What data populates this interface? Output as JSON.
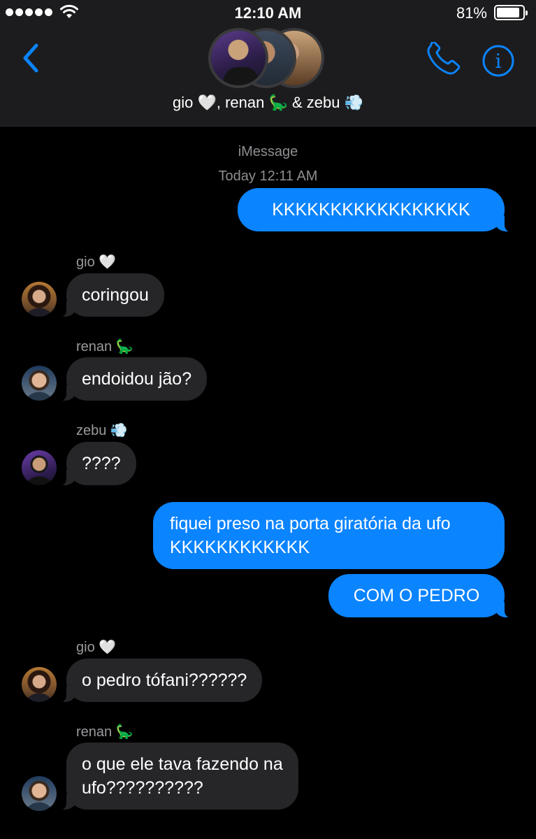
{
  "status_bar": {
    "time": "12:10 AM",
    "battery_percent": "81%",
    "battery_level": 0.81
  },
  "header": {
    "group_name": "gio 🤍, renan 🦕 & zebu 💨",
    "accent_color": "#0b84ff"
  },
  "conversation": {
    "service": "iMessage",
    "timestamp": "Today 12:11 AM",
    "messages": [
      {
        "direction": "sent",
        "text": "KKKKKKKKKKKKKKKKK"
      },
      {
        "direction": "received",
        "sender": "gio 🤍",
        "text": "coringou"
      },
      {
        "direction": "received",
        "sender": "renan 🦕",
        "text": "endoidou jão?"
      },
      {
        "direction": "received",
        "sender": "zebu 💨",
        "text": "????"
      },
      {
        "direction": "sent",
        "text": "fiquei preso na porta giratória da ufo KKKKKKKKKKKK",
        "lines": [
          "fiquei preso na porta giratória da ufo",
          "KKKKKKKKKKKK"
        ]
      },
      {
        "direction": "sent",
        "text": "COM O PEDRO"
      },
      {
        "direction": "received",
        "sender": "gio 🤍",
        "text": "o pedro tófani??????"
      },
      {
        "direction": "received",
        "sender": "renan 🦕",
        "text": "o que ele tava fazendo na ufo??????????",
        "lines": [
          "o que ele tava fazendo na",
          "ufo??????????"
        ]
      }
    ]
  },
  "colors": {
    "sent_bubble": "#0b84ff",
    "received_bubble": "#262629",
    "header_bg": "#1c1c1e",
    "background": "#000000"
  }
}
